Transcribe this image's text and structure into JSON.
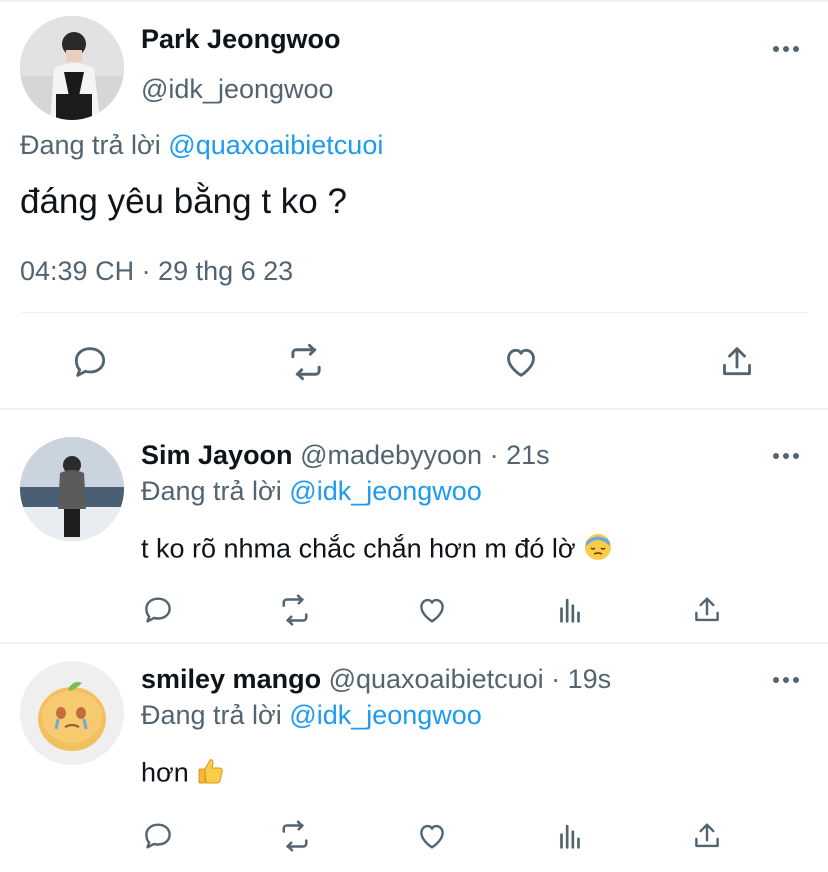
{
  "main_tweet": {
    "display_name": "Park Jeongwoo",
    "handle": "@idk_jeongwoo",
    "reply_prefix": "Đang trả lời",
    "reply_to": "@quaxoaibietcuoi",
    "text": "đáng yêu bằng t ko ?",
    "timestamp": "04:39 CH · 29 thg 6 23",
    "actions": [
      "reply-icon",
      "retweet-icon",
      "like-icon",
      "share-icon"
    ]
  },
  "replies": [
    {
      "display_name": "Sim Jayoon",
      "handle": "@madebyyoon",
      "time": "· 21s",
      "reply_prefix": "Đang trả lời",
      "reply_to": "@idk_jeongwoo",
      "text": "t ko rõ nhma chắc chắn hơn m đó lờ",
      "emoji": "sweat-face-emoji",
      "actions": [
        "reply-icon",
        "retweet-icon",
        "like-icon",
        "analytics-icon",
        "share-icon"
      ]
    },
    {
      "display_name": "smiley mango",
      "handle": "@quaxoaibietcuoi",
      "time": "· 19s",
      "reply_prefix": "Đang trả lời",
      "reply_to": "@idk_jeongwoo",
      "text": "hơn",
      "emoji": "thumbs-up-emoji",
      "actions": [
        "reply-icon",
        "retweet-icon",
        "like-icon",
        "analytics-icon",
        "share-icon"
      ]
    }
  ],
  "colors": {
    "accent": "#1d9bf0",
    "secondary_text": "#536471",
    "primary_text": "#0f1419",
    "divider": "#eff3f4"
  }
}
